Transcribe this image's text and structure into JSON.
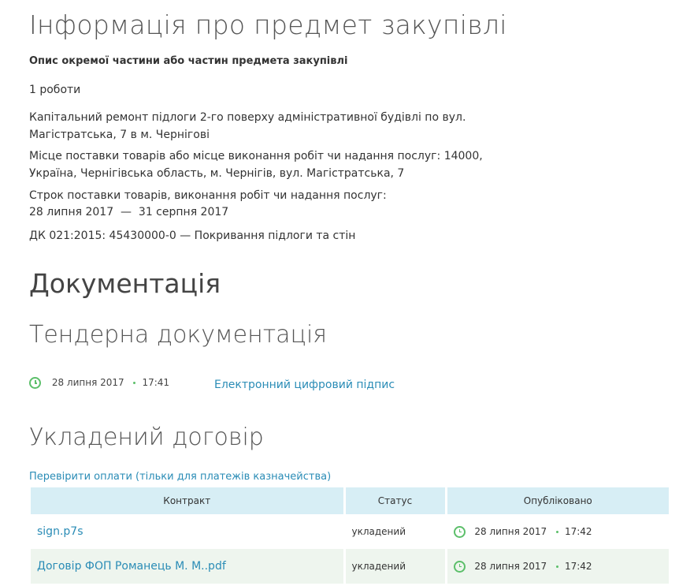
{
  "title": "Інформація про предмет закупівлі",
  "subtitle": "Опис окремої частини або частин предмета закупівлі",
  "quantity": "1 роботи",
  "description": "Капітальний ремонт підлоги 2-го поверху адміністративної будівлі по вул. Магістратська, 7 в м. Чернігові",
  "delivery_place": "Місце поставки товарів або місце виконання робіт чи надання послуг: 14000, Україна, Чернігівська область, м. Чернігів, вул. Магістратська, 7",
  "delivery_term_label": "Строк поставки товарів, виконання робіт чи надання послуг:",
  "delivery_term": "28 липня 2017  —  31 серпня 2017",
  "classifier": "ДК 021:2015: 45430000-0 — Покривання підлоги та стін",
  "documentation_heading": "Документація",
  "tender_doc_heading": "Тендерна документація",
  "tender_doc": {
    "date": "28 липня 2017",
    "time": "17:41",
    "link": "Електронний цифровий підпис"
  },
  "contract_heading": "Укладений договір",
  "check_payments_link": "Перевірити оплати (тільки для платежів казначейства)",
  "table": {
    "headers": [
      "Контракт",
      "Статус",
      "Опубліковано"
    ],
    "rows": [
      {
        "file": "sign.p7s",
        "status": "укладений",
        "date": "28 липня 2017",
        "time": "17:42"
      },
      {
        "file": "Договір ФОП Романець М. М..pdf",
        "status": "укладений",
        "date": "28 липня 2017",
        "time": "17:42"
      }
    ]
  },
  "colors": {
    "accent": "#2a8cb6",
    "clock": "#5cbf6a",
    "table_header": "#d7eef5",
    "row_alt": "#eef5ee"
  }
}
